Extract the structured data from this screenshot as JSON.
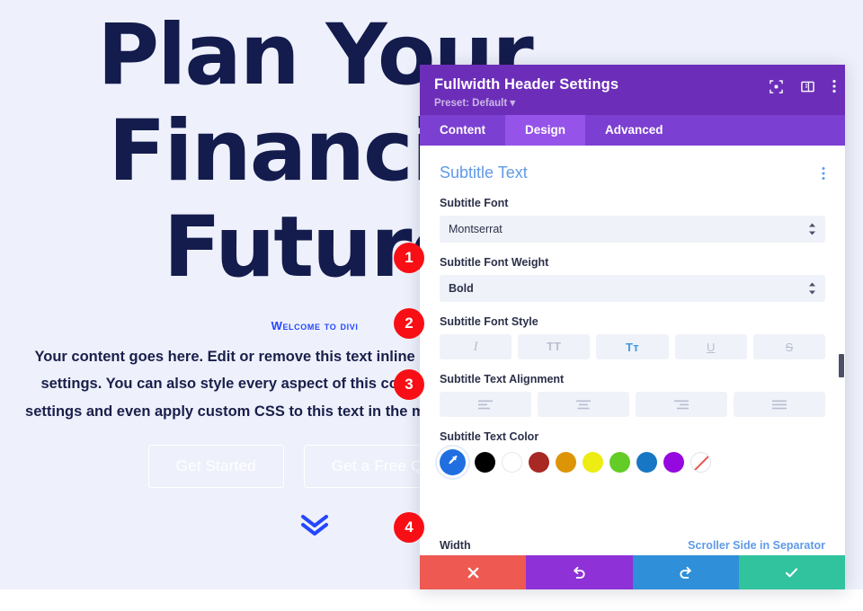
{
  "hero": {
    "title": "Plan Your Financial Future",
    "subtitle": "Welcome to Divi",
    "body": "Your content goes here. Edit or remove this text inline or in the module Content settings. You can also style every aspect of this content in the module Design settings and even apply custom CSS to this text in the module Advanced settings.",
    "buttons": [
      {
        "label": "Get Started"
      },
      {
        "label": "Get a Free Quote"
      }
    ],
    "scroll_icon": "double-chevron-down-icon",
    "title_color": "#141b4d",
    "subtitle_color": "#2547ff",
    "background_color": "#eef1fb"
  },
  "modal": {
    "title": "Fullwidth Header Settings",
    "preset": "Preset: Default",
    "header_icons": [
      {
        "name": "focus-target-icon"
      },
      {
        "name": "layout-panel-icon"
      },
      {
        "name": "more-vertical-icon"
      }
    ],
    "tabs": [
      {
        "label": "Content",
        "active": false
      },
      {
        "label": "Design",
        "active": true
      },
      {
        "label": "Advanced",
        "active": false
      }
    ],
    "header_color": "#6c2eb9",
    "tabbar_color": "#7b3fd1",
    "tab_active_color": "#9553e9",
    "section": {
      "title": "Subtitle Text",
      "menu_icon": "more-vertical-icon",
      "title_color": "#5f9ae8"
    },
    "fields": {
      "font": {
        "label": "Subtitle Font",
        "value": "Montserrat"
      },
      "font_weight": {
        "label": "Subtitle Font Weight",
        "value": "Bold"
      },
      "font_style": {
        "label": "Subtitle Font Style",
        "options": [
          {
            "name": "italic-button",
            "glyph": "I",
            "active": false
          },
          {
            "name": "uppercase-button",
            "glyph": "TT",
            "active": false
          },
          {
            "name": "small-caps-button",
            "glyph": "Tᴛ",
            "active": true
          },
          {
            "name": "underline-button",
            "glyph": "U",
            "active": false
          },
          {
            "name": "strikethrough-button",
            "glyph": "S",
            "active": false
          }
        ]
      },
      "text_alignment": {
        "label": "Subtitle Text Alignment",
        "options": [
          {
            "name": "align-left-button"
          },
          {
            "name": "align-center-button"
          },
          {
            "name": "align-right-button"
          },
          {
            "name": "align-justify-button"
          }
        ]
      },
      "text_color": {
        "label": "Subtitle Text Color",
        "eyedropper": {
          "name": "eyedropper-button",
          "color": "#1f6fe0"
        },
        "swatches": [
          {
            "name": "swatch-black",
            "color": "#000000"
          },
          {
            "name": "swatch-white",
            "color": "#ffffff"
          },
          {
            "name": "swatch-dark-red",
            "color": "#a82824"
          },
          {
            "name": "swatch-orange",
            "color": "#dd9507"
          },
          {
            "name": "swatch-yellow",
            "color": "#eded13"
          },
          {
            "name": "swatch-green",
            "color": "#63cc26"
          },
          {
            "name": "swatch-blue",
            "color": "#1777c4"
          },
          {
            "name": "swatch-purple",
            "color": "#9509e0"
          },
          {
            "name": "swatch-transparent",
            "color": "transparent"
          }
        ]
      }
    },
    "next_row": {
      "left_label": "Width",
      "right_label": "Scroller Side in Separator"
    },
    "footer": [
      {
        "name": "cancel-button",
        "icon": "close-icon",
        "color": "#ee5952"
      },
      {
        "name": "undo-button",
        "icon": "undo-icon",
        "color": "#8e31d6"
      },
      {
        "name": "redo-button",
        "icon": "redo-icon",
        "color": "#2f8fd8"
      },
      {
        "name": "save-button",
        "icon": "check-icon",
        "color": "#30c39e"
      }
    ]
  },
  "badges": [
    {
      "number": "1"
    },
    {
      "number": "2"
    },
    {
      "number": "3"
    },
    {
      "number": "4"
    }
  ]
}
